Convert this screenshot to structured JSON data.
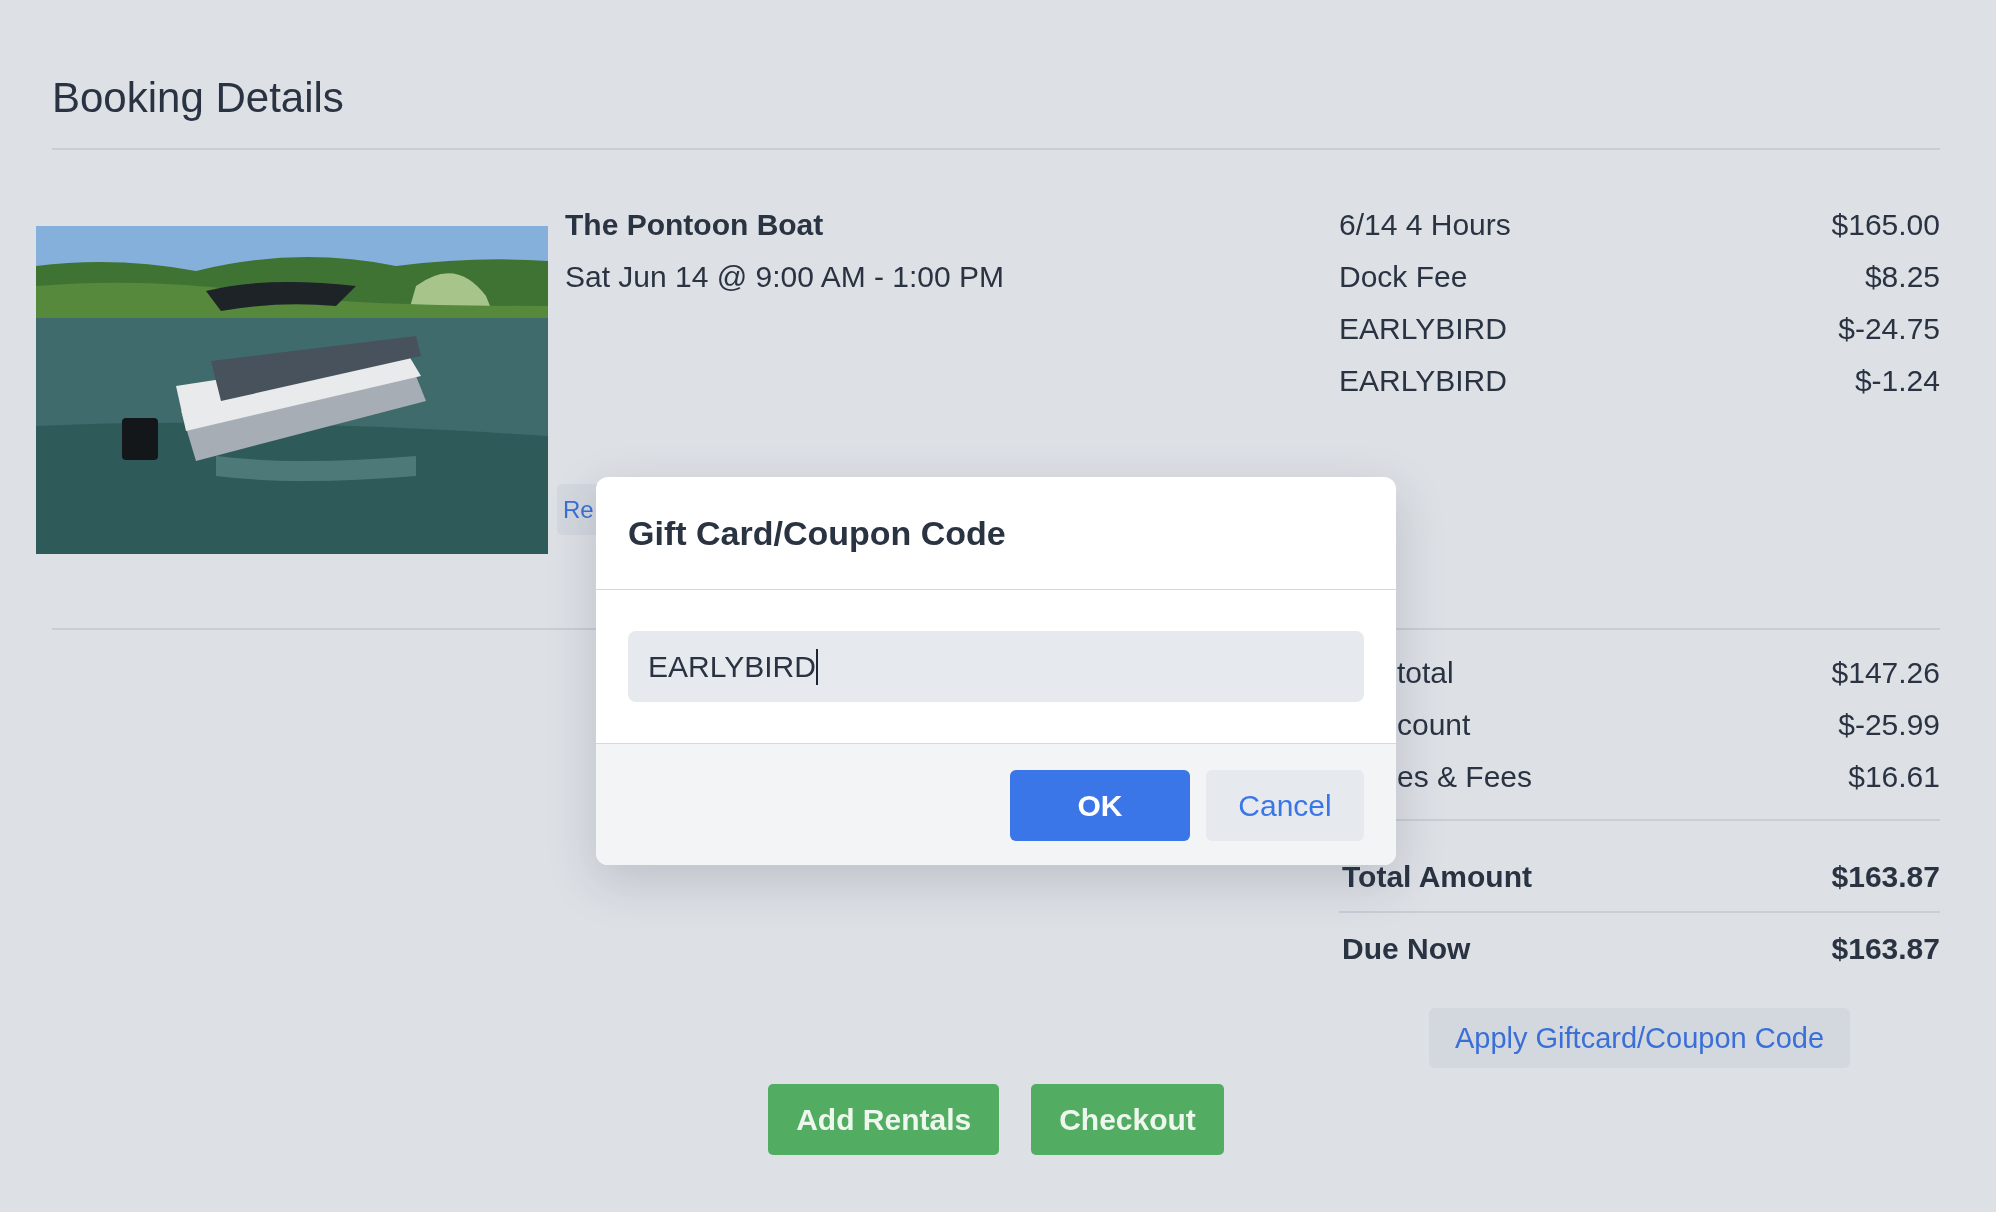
{
  "page": {
    "title": "Booking Details"
  },
  "booking": {
    "name": "The Pontoon Boat",
    "when": "Sat Jun 14 @ 9:00 AM - 1:00 PM",
    "cut_button": "Re"
  },
  "line_items": [
    {
      "label": "6/14 4 Hours",
      "amount": "$165.00"
    },
    {
      "label": "Dock Fee",
      "amount": "$8.25"
    },
    {
      "label": "EARLYBIRD",
      "amount": "$-24.75"
    },
    {
      "label": "EARLYBIRD",
      "amount": "$-1.24"
    }
  ],
  "summary_lines": [
    {
      "label": "total",
      "amount": "$147.26"
    },
    {
      "label": "count",
      "amount": "$-25.99"
    },
    {
      "label": "es & Fees",
      "amount": "$16.61"
    }
  ],
  "totals": [
    {
      "label": "Total Amount",
      "amount": "$163.87"
    },
    {
      "label": "Due Now",
      "amount": "$163.87"
    }
  ],
  "apply_button": "Apply Giftcard/Coupon Code",
  "actions": [
    "Add Rentals",
    "Checkout"
  ],
  "dialog": {
    "title": "Gift Card/Coupon Code",
    "code_value": "EARLYBIRD",
    "buttons": [
      {
        "label": "OK",
        "kind": "primary"
      },
      {
        "label": "Cancel",
        "kind": "secondary"
      }
    ]
  }
}
